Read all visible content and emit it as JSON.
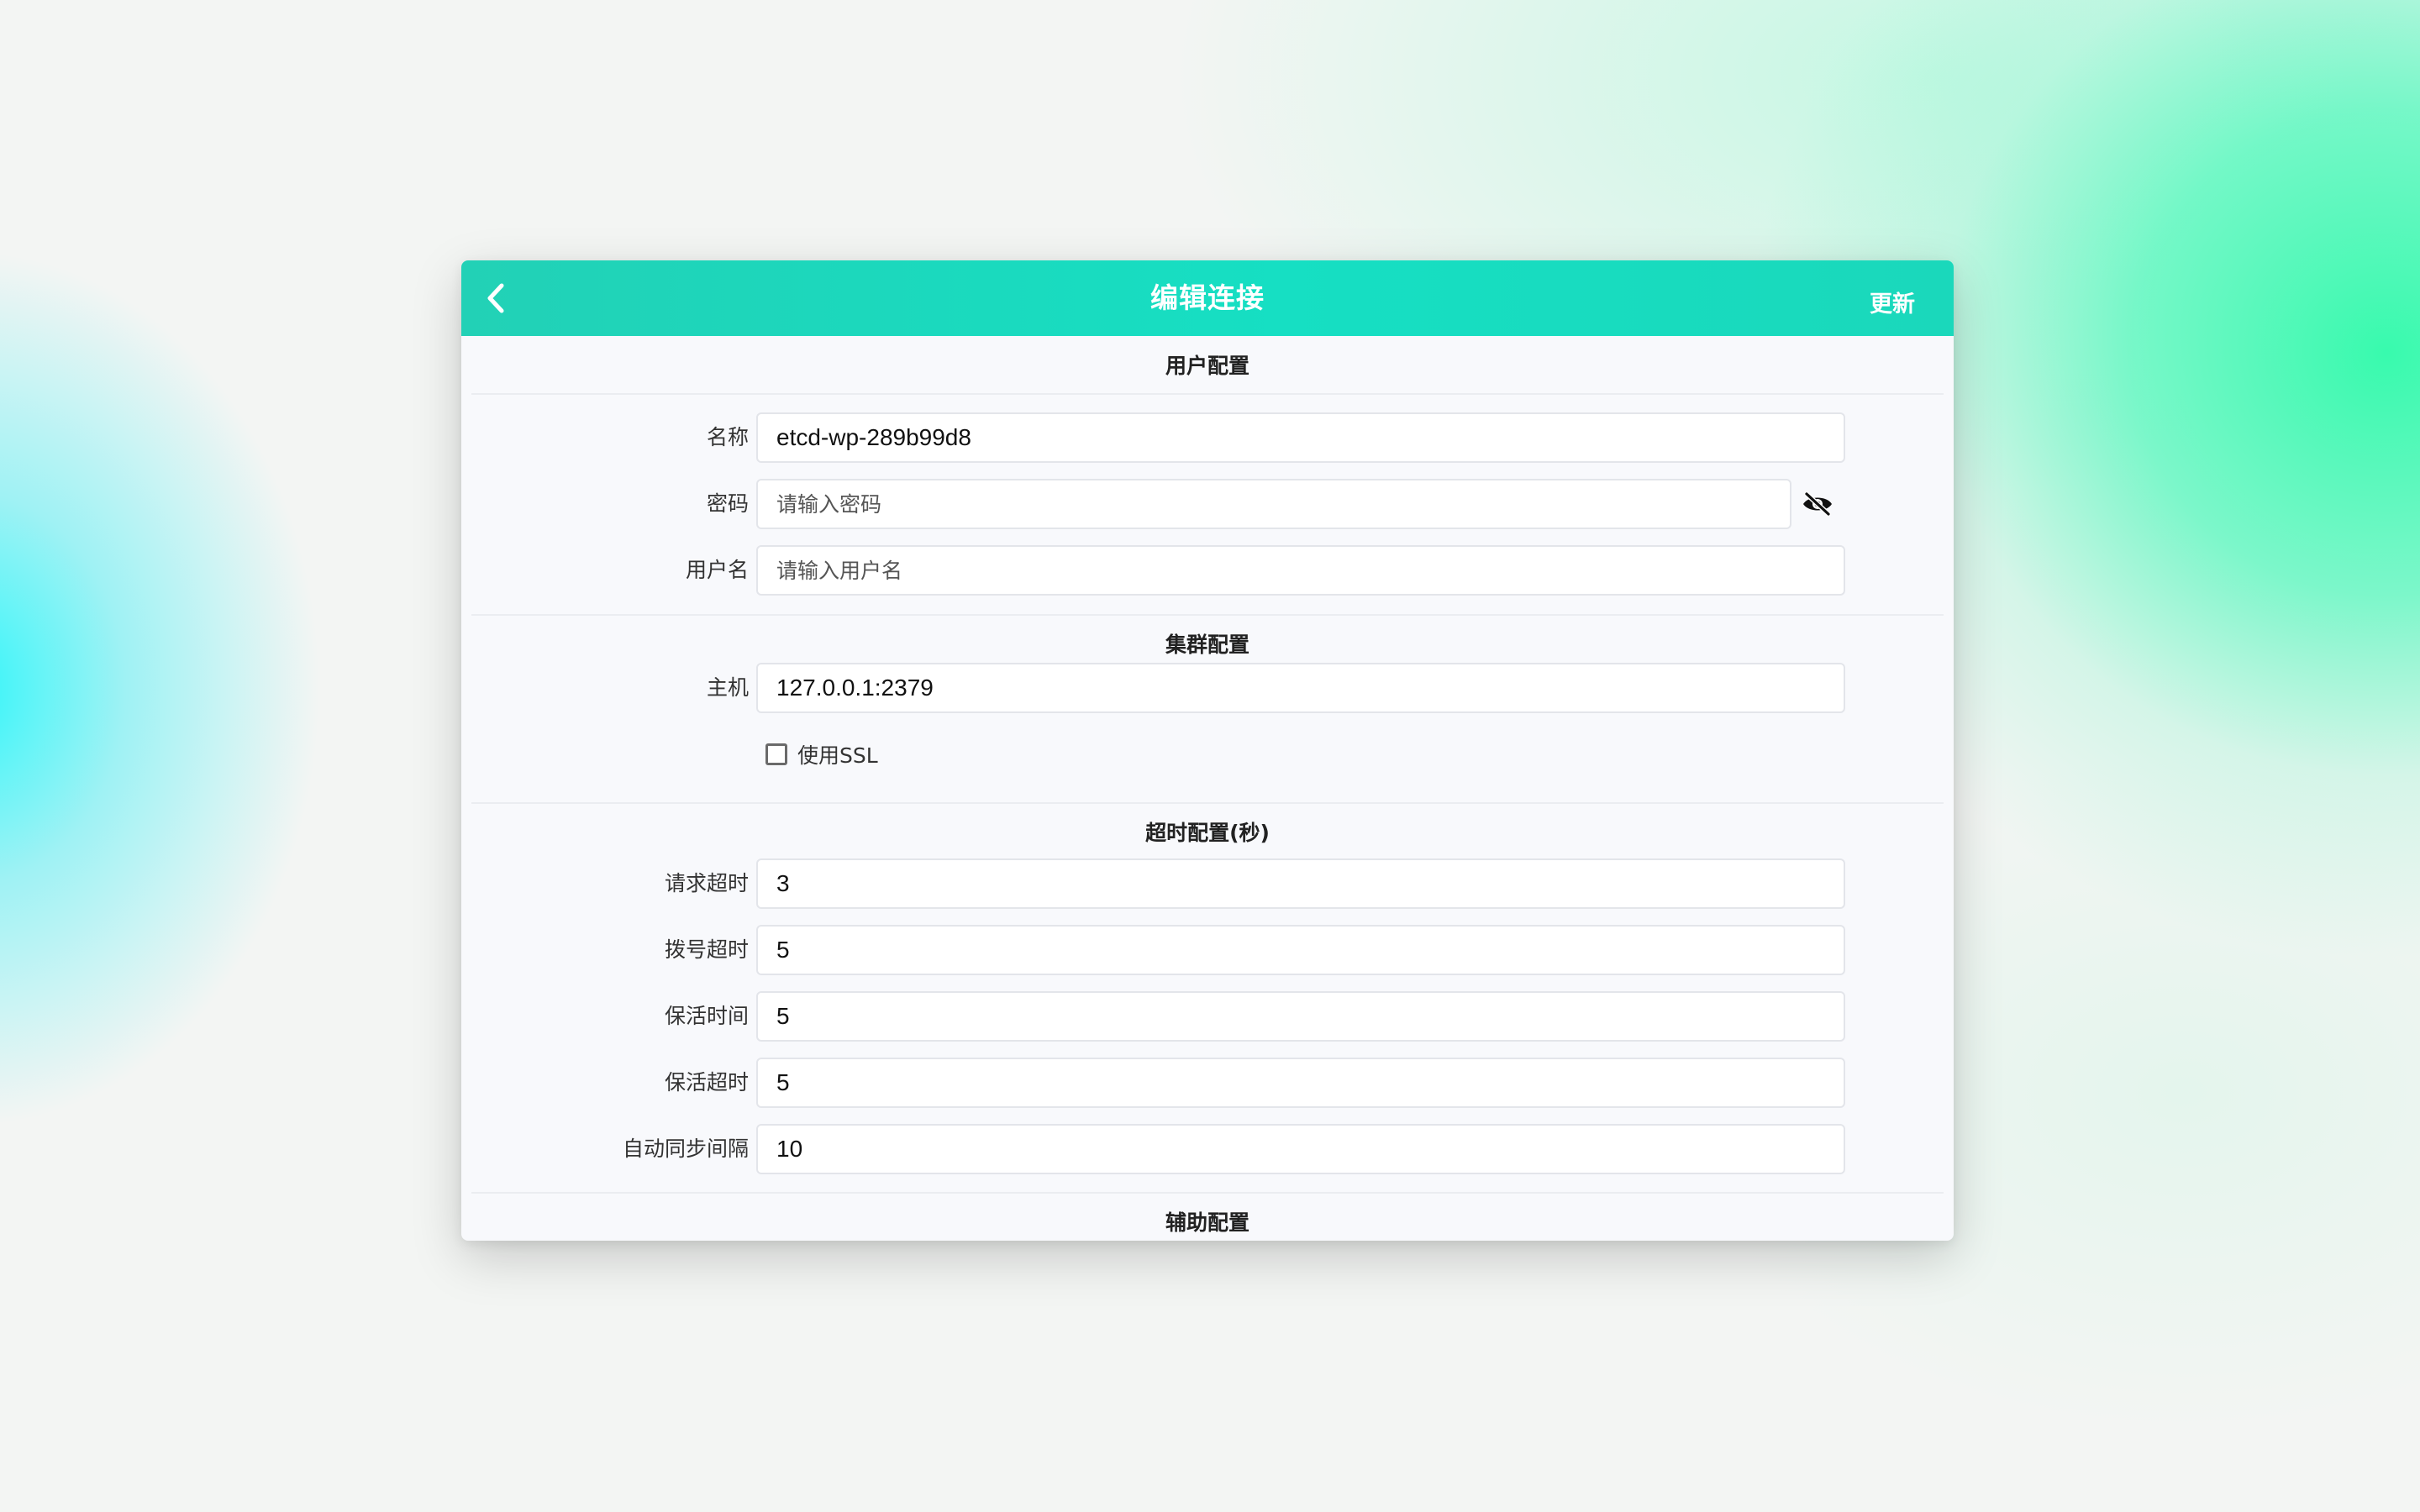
{
  "header": {
    "title": "编辑连接",
    "update_label": "更新"
  },
  "sections": {
    "user": "用户配置",
    "cluster": "集群配置",
    "timeout": "超时配置(秒)",
    "aux": "辅助配置"
  },
  "user": {
    "name_label": "名称",
    "name_value": "etcd-wp-289b99d8",
    "password_label": "密码",
    "password_placeholder": "请输入密码",
    "username_label": "用户名",
    "username_placeholder": "请输入用户名"
  },
  "cluster": {
    "host_label": "主机",
    "host_value": "127.0.0.1:2379",
    "ssl_label": "使用SSL",
    "ssl_checked": false
  },
  "timeout": {
    "request_label": "请求超时",
    "request_value": "3",
    "dial_label": "拨号超时",
    "dial_value": "5",
    "keepalive_time_label": "保活时间",
    "keepalive_time_value": "5",
    "keepalive_timeout_label": "保活超时",
    "keepalive_timeout_value": "5",
    "autosync_label": "自动同步间隔",
    "autosync_value": "10"
  },
  "icons": {
    "back": "chevron-left-icon",
    "password_toggle": "eye-off-icon"
  },
  "colors": {
    "header_accent": "#1adcbf",
    "background_glow_right": "#2efaaa",
    "background_glow_left": "#28f5fa"
  }
}
